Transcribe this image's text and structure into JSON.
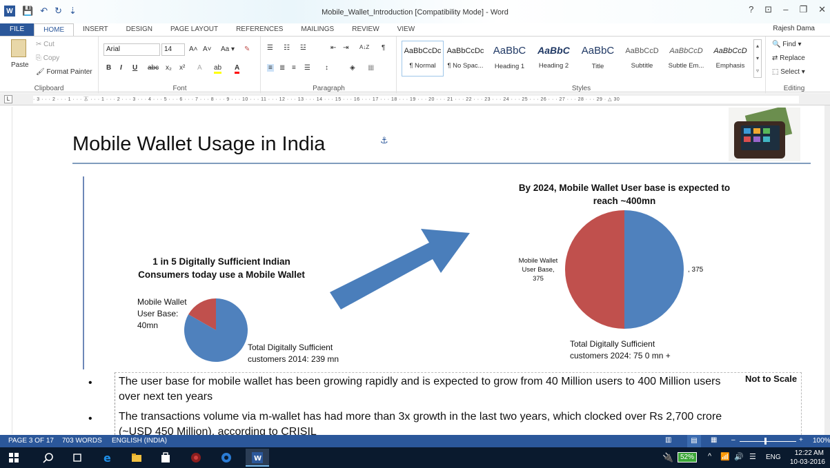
{
  "window": {
    "title": "Mobile_Wallet_Introduction [Compatibility Mode] - Word",
    "user": "Rajesh Dama"
  },
  "window_controls": {
    "help": "?",
    "ribbon_display": "⊡",
    "minimize": "–",
    "restore": "❐",
    "close": "✕"
  },
  "qat": {
    "save": "💾",
    "undo": "↶",
    "redo": "↻",
    "customize": "⇣"
  },
  "tabs": [
    "FILE",
    "HOME",
    "INSERT",
    "DESIGN",
    "PAGE LAYOUT",
    "REFERENCES",
    "MAILINGS",
    "REVIEW",
    "VIEW"
  ],
  "clipboard": {
    "paste": "Paste",
    "cut": "Cut",
    "copy": "Copy",
    "format_painter": "Format Painter",
    "label": "Clipboard"
  },
  "font": {
    "name": "Arial",
    "size": "14",
    "label": "Font",
    "grow": "A˄",
    "shrink": "A˅",
    "case": "Aa ▾",
    "clear": "✎",
    "bold": "B",
    "italic": "I",
    "underline": "U",
    "strike": "abc",
    "subscript": "x₂",
    "superscript": "x²",
    "effects": "A",
    "highlight": "ab",
    "color": "A"
  },
  "paragraph": {
    "label": "Paragraph",
    "bullets": "☰",
    "numbering": "☷",
    "multilevel": "☳",
    "dec_indent": "⇤",
    "inc_indent": "⇥",
    "sort": "A↓Z",
    "pilcrow": "¶",
    "align_left": "≡",
    "center": "≣",
    "align_right": "≡",
    "justify": "☰",
    "line_spacing": "↕",
    "shading": "◈",
    "borders": "▦"
  },
  "styles": {
    "label": "Styles",
    "items": [
      {
        "preview": "AaBbCcDc",
        "name": "¶ Normal"
      },
      {
        "preview": "AaBbCcDc",
        "name": "¶ No Spac..."
      },
      {
        "preview": "AaBbC",
        "name": "Heading 1"
      },
      {
        "preview": "AaBbC",
        "name": "Heading 2"
      },
      {
        "preview": "AaBbC",
        "name": "Title"
      },
      {
        "preview": "AaBbCcD",
        "name": "Subtitle"
      },
      {
        "preview": "AaBbCcD",
        "name": "Subtle Em..."
      },
      {
        "preview": "AaBbCcD",
        "name": "Emphasis"
      }
    ]
  },
  "editing": {
    "find": "Find ▾",
    "replace": "Replace",
    "select": "Select ▾",
    "label": "Editing"
  },
  "ruler": {
    "text": "· 3 · · · 2 · · · 1 · · · ⏄ · · · 1 · · · 2 · · · 3 · · · 4 · · · 5 · · · 6 · · · 7 · · · 8 · · · 9 · · · 10 · · · 11 · · · 12 · · · 13 · · · 14 · · · 15 · · · 16 · · · 17 · · · 18 · · · 19 · · · 20 · · · 21 · · · 22 · · · 23 · · · 24 · · · 25 · · · 26 · · · 27 · · · 28 · · · 29 · △ 30"
  },
  "document": {
    "title": "Mobile Wallet Usage in India",
    "anchor": "⚓",
    "chart1_title": "1 in 5 Digitally Sufficient Indian Consumers today use a Mobile Wallet",
    "chart1_label_a": "Mobile Wallet User Base: 40mn",
    "chart1_label_b": "Total Digitally Sufficient customers 2014: 239 mn",
    "chart2_title": "By 2024, Mobile Wallet User base is expected to reach ~400mn",
    "chart2_label_a": "Mobile Wallet User Base, 375",
    "chart2_label_b": ", 375",
    "chart2_label_c": "Total Digitally Sufficient customers 2024: 75 0 mn +",
    "note": "Not to Scale",
    "bullet_char": "•",
    "bullets": [
      "The user base for mobile wallet has been growing rapidly and is expected to grow from 40 Million users to 400 Million users over next ten years",
      "The transactions volume via m-wallet has had more than 3x growth in the last two years, which clocked over Rs 2,700 crore (~USD 450 Million), according to CRISIL"
    ]
  },
  "chart_data": [
    {
      "type": "pie",
      "title": "1 in 5 Digitally Sufficient Indian Consumers today use a Mobile Wallet",
      "slices": [
        {
          "label": "Mobile Wallet User Base: 40mn",
          "value": 40,
          "color": "#c0504d"
        },
        {
          "label": "Total Digitally Sufficient customers 2014: 239 mn",
          "value": 199,
          "color": "#4f81bd"
        }
      ]
    },
    {
      "type": "pie",
      "title": "By 2024, Mobile Wallet User base is expected to reach ~400mn",
      "slices": [
        {
          "label": "Mobile Wallet User Base, 375",
          "value": 375,
          "color": "#c0504d"
        },
        {
          "label": ", 375",
          "value": 375,
          "color": "#4f81bd"
        }
      ]
    }
  ],
  "status": {
    "page": "PAGE 3 OF 17",
    "words": "703 WORDS",
    "lang": "ENGLISH (INDIA)",
    "zoom": "100%",
    "zoom_minus": "–",
    "zoom_plus": "+"
  },
  "taskbar": {
    "battery": "52%",
    "kb": "ENG",
    "time": "12:22 AM",
    "date": "10-03-2016"
  },
  "colors": {
    "brand": "#2b579a",
    "pie_red": "#c0504d",
    "pie_blue": "#4f81bd",
    "arrow": "#4a7ebb"
  }
}
